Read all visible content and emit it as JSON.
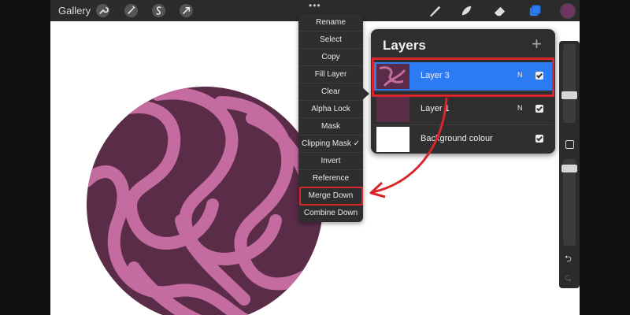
{
  "topbar": {
    "gallery_label": "Gallery",
    "more_dots": "•••",
    "tools_left": [
      "wrench-icon",
      "magic-wand-icon",
      "selection-s-icon",
      "transform-arrow-icon"
    ],
    "tools_right": [
      "brush-icon",
      "smudge-icon",
      "eraser-icon",
      "layers-icon"
    ],
    "current_color": "#6d3560"
  },
  "layer_menu": {
    "items": [
      "Rename",
      "Select",
      "Copy",
      "Fill Layer",
      "Clear",
      "Alpha Lock",
      "Mask",
      "Clipping Mask ✓",
      "Invert",
      "Reference",
      "Merge Down",
      "Combine Down"
    ],
    "highlighted_item": "Merge Down"
  },
  "layers_panel": {
    "title": "Layers",
    "add_symbol": "+",
    "layers": [
      {
        "name": "Layer 3",
        "mode": "N",
        "visible": true,
        "active": true
      },
      {
        "name": "Layer 1",
        "mode": "N",
        "visible": true,
        "active": false
      },
      {
        "name": "Background colour",
        "mode": "",
        "visible": true,
        "active": false
      }
    ]
  },
  "sidebar": {
    "undo_symbol": "⮌",
    "redo_symbol": "⮎"
  },
  "colors": {
    "accent_blue": "#2c7bf2",
    "annotation_red": "#d8262b",
    "swirl_dark": "#5a2c48",
    "swirl_light": "#c46ca0"
  }
}
